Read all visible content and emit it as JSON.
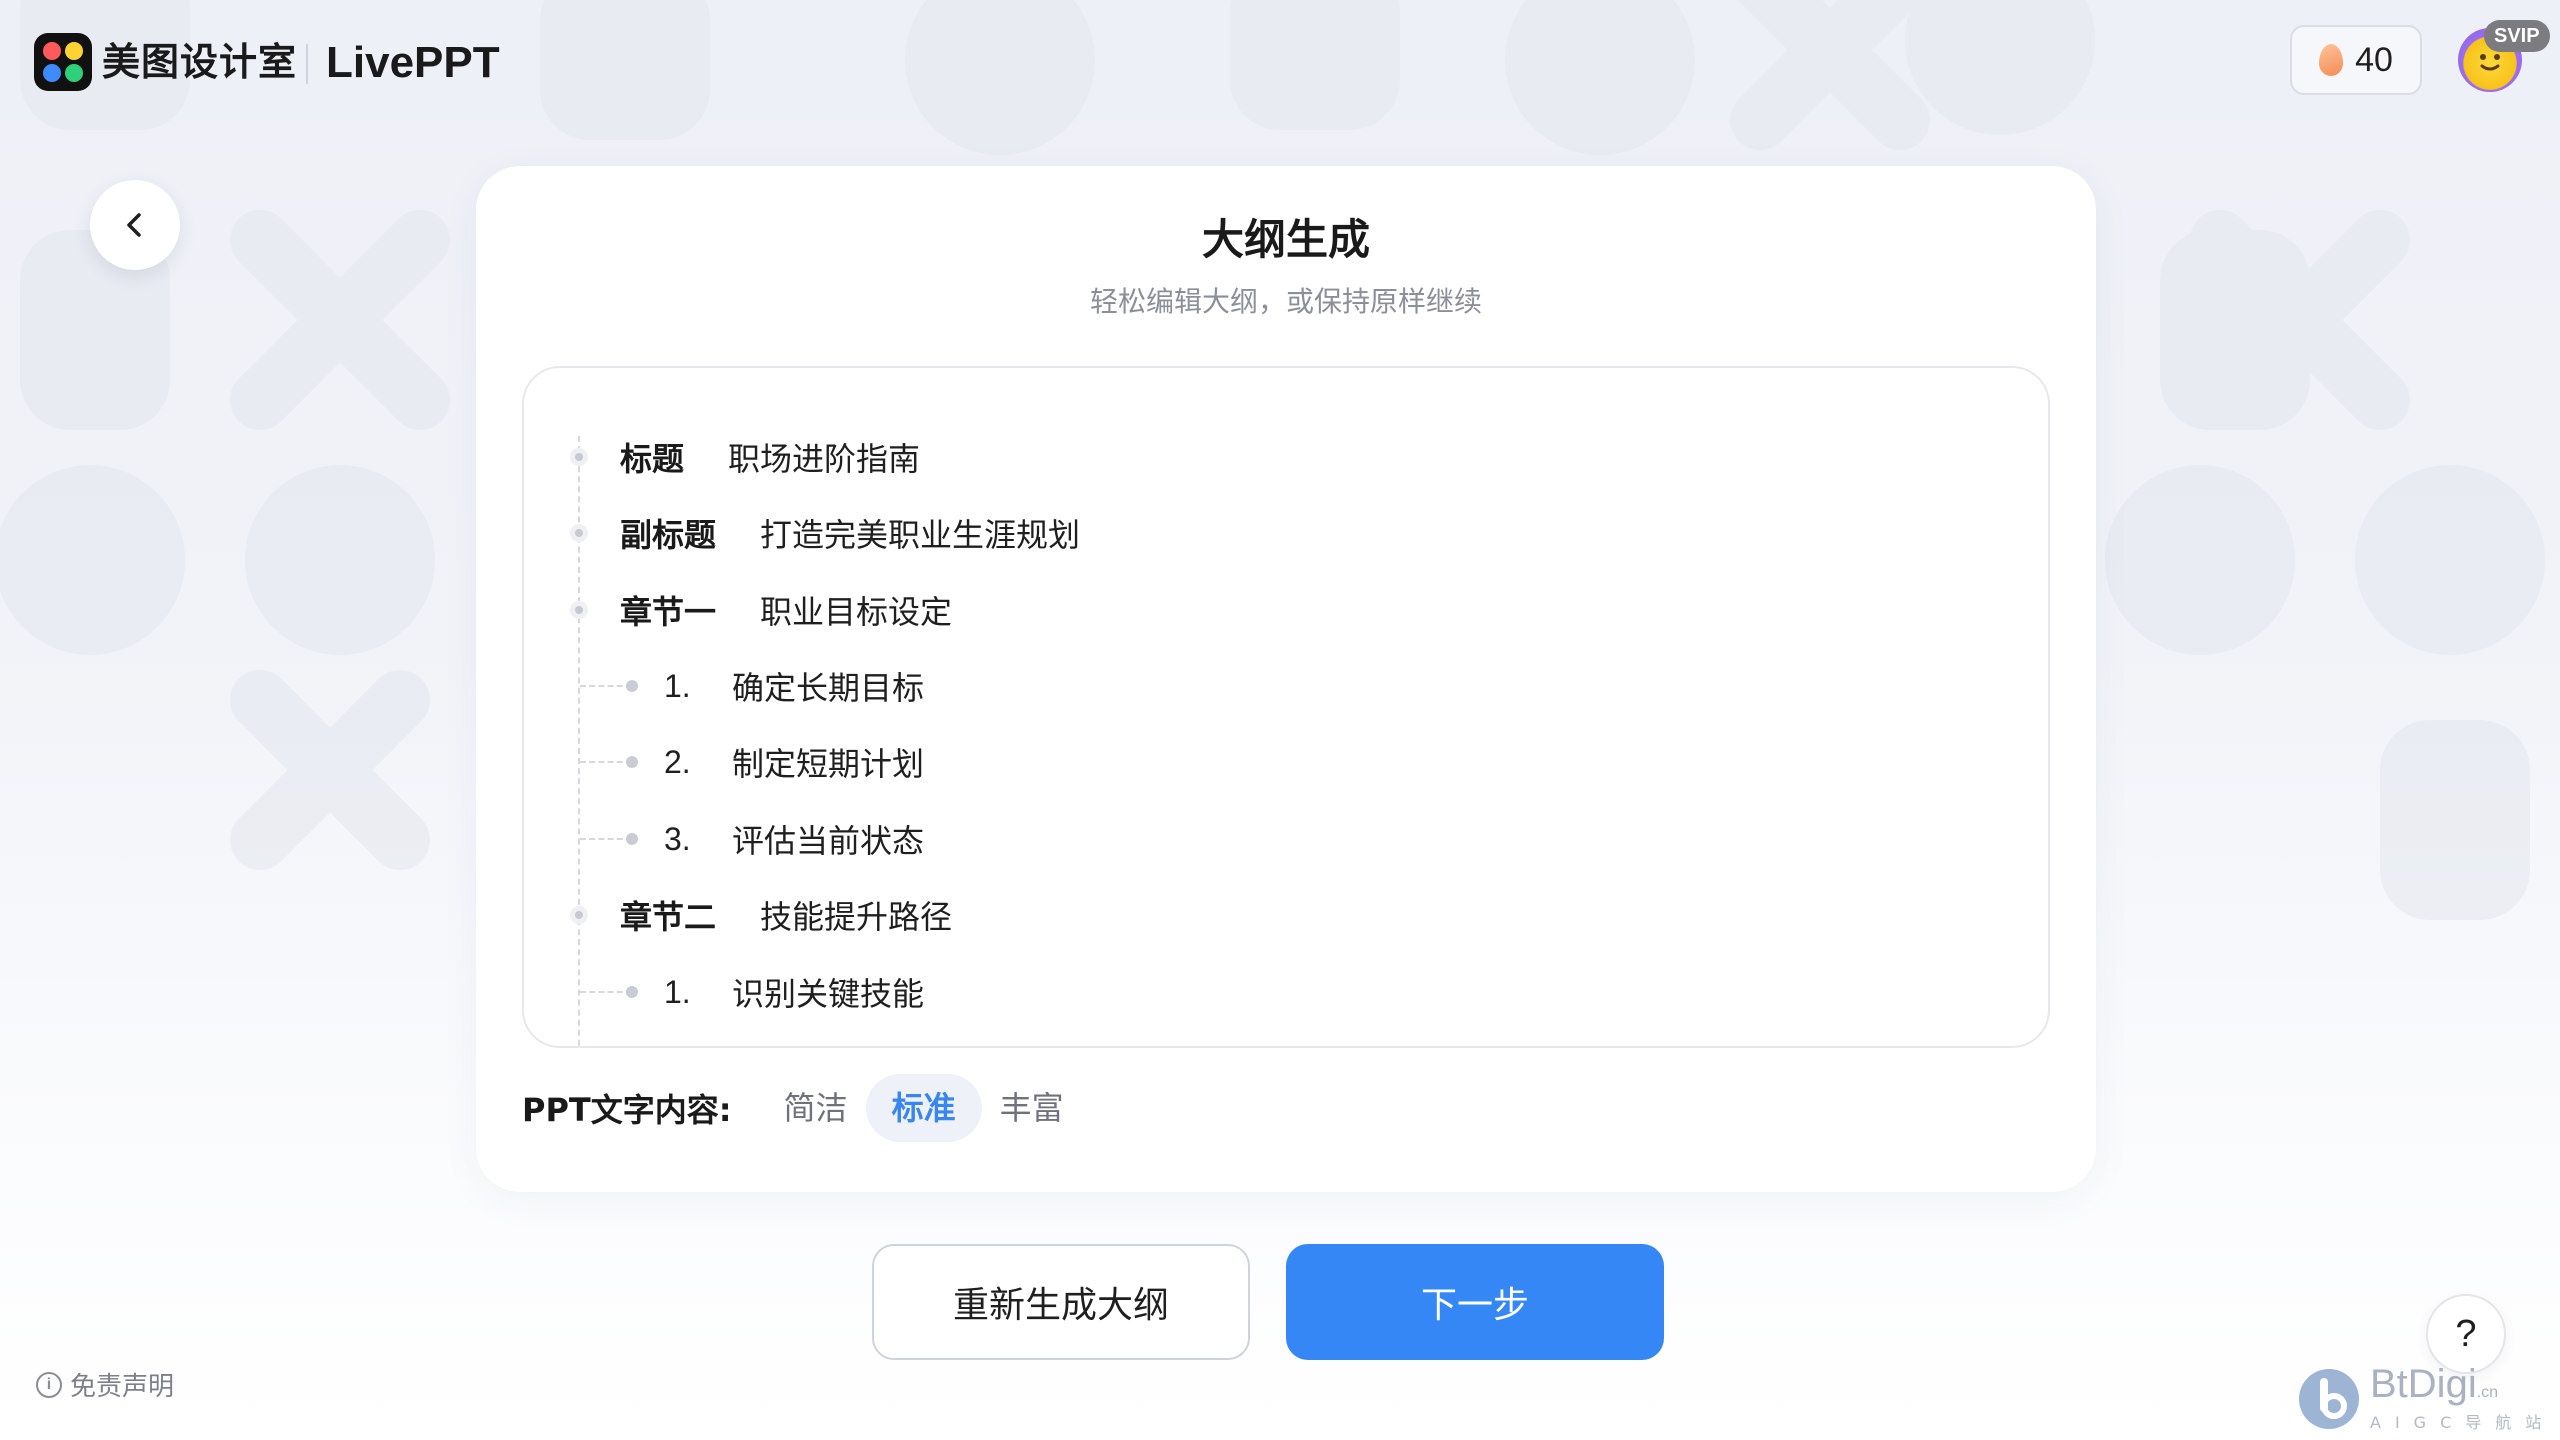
{
  "header": {
    "brand_name": "美图设计室",
    "product_name": "LivePPT",
    "credits": "40",
    "vip_badge": "SVIP"
  },
  "card": {
    "title": "大纲生成",
    "subtitle": "轻松编辑大纲，或保持原样继续"
  },
  "outline": {
    "items": [
      {
        "label": "标题",
        "text": "职场进阶指南"
      },
      {
        "label": "副标题",
        "text": "打造完美职业生涯规划"
      },
      {
        "label": "章节一",
        "text": "职业目标设定"
      },
      {
        "num": "1.",
        "text": "确定长期目标"
      },
      {
        "num": "2.",
        "text": "制定短期计划"
      },
      {
        "num": "3.",
        "text": "评估当前状态"
      },
      {
        "label": "章节二",
        "text": "技能提升路径"
      },
      {
        "num": "1.",
        "text": "识别关键技能"
      }
    ]
  },
  "density": {
    "label": "PPT文字内容:",
    "options": [
      "简洁",
      "标准",
      "丰富"
    ],
    "selected": "标准"
  },
  "actions": {
    "regenerate": "重新生成大纲",
    "next": "下一步"
  },
  "footer": {
    "disclaimer": "免责声明",
    "help": "?"
  },
  "watermark": {
    "main": "BtDigi",
    "suffix": ".cn",
    "sub": "AIGC导航站"
  },
  "colors": {
    "accent": "#3487f5",
    "selected_bg": "#eef2f8"
  }
}
